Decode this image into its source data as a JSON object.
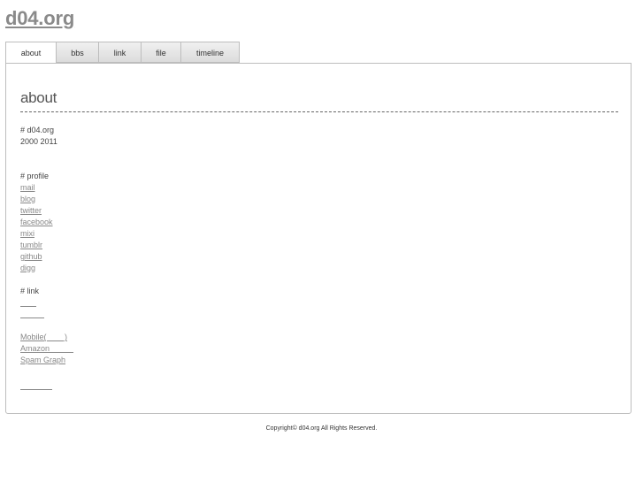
{
  "site": {
    "title": "d04.org"
  },
  "tabs": [
    {
      "label": "about",
      "active": true
    },
    {
      "label": "bbs"
    },
    {
      "label": "link"
    },
    {
      "label": "file"
    },
    {
      "label": "timeline"
    }
  ],
  "content": {
    "heading": "about",
    "intro": {
      "title": "# d04.org",
      "years": "2000 2011"
    },
    "profile": {
      "title": "# profile",
      "links": [
        "mail",
        "blog",
        "twitter",
        "facebook",
        "mixi",
        "tumblr",
        "github",
        "digg"
      ]
    },
    "link_section": {
      "title": "# link",
      "blank_links": [
        "　　",
        "　　　"
      ],
      "links": [
        "Mobile(　 　)",
        "Amazon　　　",
        "Spam Graph"
      ],
      "trailing_link": "　　　　"
    }
  },
  "footer": {
    "text": "Copyright© d04.org All Rights Reserved."
  }
}
